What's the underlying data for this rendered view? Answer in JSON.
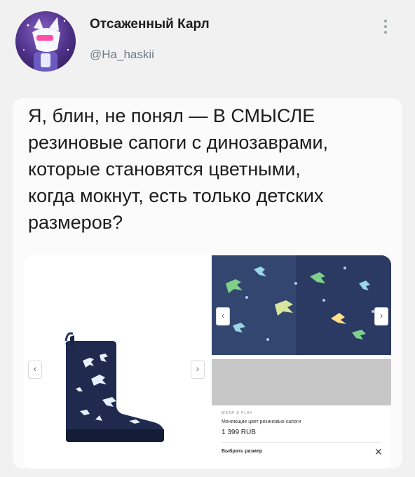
{
  "author": {
    "name": "Отсаженный Карл",
    "handle": "@Ha_haskii"
  },
  "icons": {
    "more": "more-vertical-icon",
    "prev": "chevron-left-icon",
    "next": "chevron-right-icon",
    "close": "close-icon"
  },
  "tweet": {
    "lines": [
      "Я, блин, не понял — В СМЫСЛЕ",
      "резиновые сапоги с динозаврами,",
      "которые становятся цветными,",
      "когда мокнут, есть только детских",
      "размеров?"
    ]
  },
  "product": {
    "brand": "WEAR & PLAY",
    "title": "Меняющие цвет резиновые сапоги",
    "price": "1 399 RUB",
    "size_button": "Выбрать размер",
    "arrows": {
      "prev": "‹",
      "next": "›"
    },
    "close": "✕"
  },
  "colors": {
    "background": "#f1f1f1",
    "card": "#fbfbfb",
    "boot_navy": "#1f2a4e",
    "handle_gray": "#6e7a84"
  }
}
